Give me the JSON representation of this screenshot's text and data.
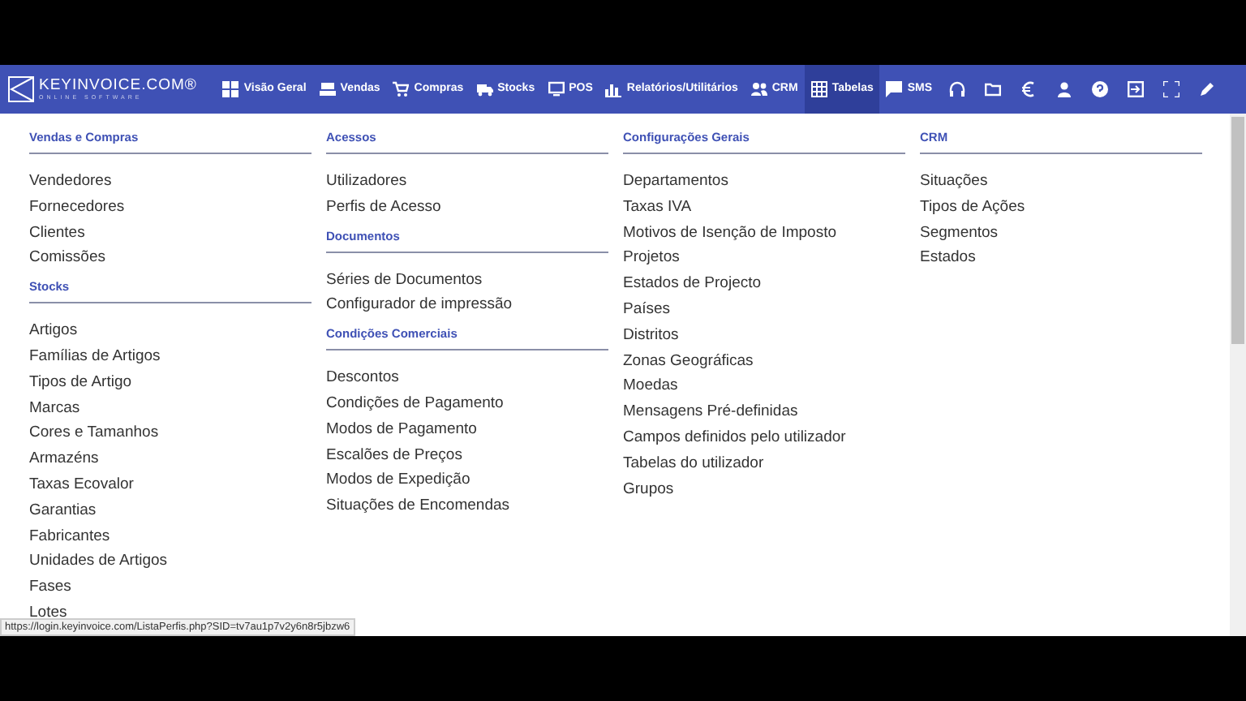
{
  "nav": {
    "logo": {
      "title": "KEYINVOICE.COM®",
      "subtitle": "ONLINE SOFTWARE"
    },
    "items": [
      {
        "label": "Visão Geral",
        "selected": false
      },
      {
        "label": "Vendas",
        "selected": false
      },
      {
        "label": "Compras",
        "selected": false
      },
      {
        "label": "Stocks",
        "selected": false
      },
      {
        "label": "POS",
        "selected": false
      },
      {
        "label": "Relatórios/Utilitários",
        "selected": false
      },
      {
        "label": "CRM",
        "selected": false
      },
      {
        "label": "Tabelas",
        "selected": true
      },
      {
        "label": "SMS",
        "selected": false
      }
    ]
  },
  "columns": [
    {
      "sections": [
        {
          "heading": "Vendas e Compras",
          "items": [
            "Vendedores",
            "Fornecedores",
            "Clientes",
            "Comissões"
          ]
        },
        {
          "heading": "Stocks",
          "items": [
            "Artigos",
            "Famílias de Artigos",
            "Tipos de Artigo",
            "Marcas",
            "Cores e Tamanhos",
            "Armazéns",
            "Taxas Ecovalor",
            "Garantias",
            "Fabricantes",
            "Unidades de Artigos",
            "Fases",
            "Lotes"
          ]
        }
      ]
    },
    {
      "sections": [
        {
          "heading": "Acessos",
          "items": [
            "Utilizadores",
            "Perfis de Acesso"
          ]
        },
        {
          "heading": "Documentos",
          "items": [
            "Séries de Documentos",
            "Configurador de impressão"
          ]
        },
        {
          "heading": "Condições Comerciais",
          "items": [
            "Descontos",
            "Condições de Pagamento",
            "Modos de Pagamento",
            "Escalões de Preços",
            "Modos de Expedição",
            "Situações de Encomendas"
          ]
        }
      ]
    },
    {
      "sections": [
        {
          "heading": "Configurações Gerais",
          "items": [
            "Departamentos",
            "Taxas IVA",
            "Motivos de Isenção de Imposto",
            "Projetos",
            "Estados de Projecto",
            "Países",
            "Distritos",
            "Zonas Geográficas",
            "Moedas",
            "Mensagens Pré-definidas",
            "Campos definidos pelo utilizador",
            "Tabelas do utilizador",
            "Grupos"
          ]
        }
      ]
    },
    {
      "sections": [
        {
          "heading": "CRM",
          "items": [
            "Situações",
            "Tipos de Ações",
            "Segmentos",
            "Estados"
          ]
        }
      ]
    }
  ],
  "status_bar": {
    "url": "https://login.keyinvoice.com/ListaPerfis.php?SID=tv7au1p7v2y6n8r5jbzw6"
  }
}
